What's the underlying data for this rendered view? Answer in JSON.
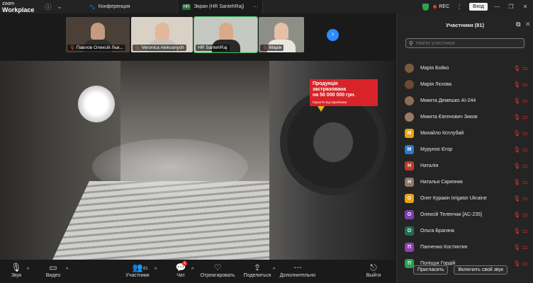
{
  "topbar": {
    "brand_line1": "zoom",
    "brand_line2": "Workplace",
    "tab1": "Конференция",
    "tab2_tag": "HR",
    "tab2": "Экран (HR SantehRaj)",
    "rec": "REC",
    "login": "Вход"
  },
  "thumbs": [
    {
      "label": "Павлов Олексій Льв...",
      "muted": true,
      "active": false
    },
    {
      "label": "Veronica Aleksanych",
      "muted": true,
      "active": false
    },
    {
      "label": "HR SantehRaj",
      "muted": false,
      "active": true
    },
    {
      "label": "Марія",
      "muted": true,
      "active": false
    }
  ],
  "promo": {
    "line1": "Продукція",
    "line2": "застрахована",
    "line3": "на 50 000 000 грн.",
    "line4": "Гарантія від виробника"
  },
  "toolbar": {
    "mic": "Звук",
    "video": "Видео",
    "participants": "Участники",
    "participants_count": "81",
    "chat": "Чат",
    "chat_badge": "1",
    "react": "Отреагировать",
    "share": "Поделиться",
    "more": "Дополнительно",
    "leave": "Выйти"
  },
  "panel": {
    "title": "Участники (81)",
    "search_placeholder": "Найти участника",
    "invite": "Пригласить",
    "enable_audio": "Включить свой звук",
    "participants": [
      {
        "name": "Марія Бойко",
        "initial": "",
        "color": "#7a5a3c",
        "photo": true
      },
      {
        "name": "Марія Лєхова",
        "initial": "",
        "color": "#6b4a32",
        "photo": true
      },
      {
        "name": "Микита Демешко АІ-244",
        "initial": "",
        "color": "#8a6d55",
        "photo": true
      },
      {
        "name": "Микита Євгенович Зиков",
        "initial": "",
        "color": "#9a7a62",
        "photo": true
      },
      {
        "name": "Михайло Котлубай",
        "initial": "М",
        "color": "#e8a317",
        "photo": false
      },
      {
        "name": "Муруноє Єгор",
        "initial": "М",
        "color": "#2f79c8",
        "photo": false
      },
      {
        "name": "Наталія",
        "initial": "Н",
        "color": "#c0392b",
        "photo": false
      },
      {
        "name": "Наталья Скрипник",
        "initial": "Н",
        "color": "#8a7a6a",
        "photo": false
      },
      {
        "name": "Олег Куракін Irrigator Ukraine",
        "initial": "О",
        "color": "#e8a317",
        "photo": false
      },
      {
        "name": "Олексій Теленчак [AC-235]",
        "initial": "О",
        "color": "#7b3fb0",
        "photo": false
      },
      {
        "name": "Ольга Брагина",
        "initial": "О",
        "color": "#1e6e4e",
        "photo": false
      },
      {
        "name": "Панченко Костянтин",
        "initial": "П",
        "color": "#8e3fb0",
        "photo": false
      },
      {
        "name": "Поліщук Гордій",
        "initial": "П",
        "color": "#2e9e4e",
        "photo": false
      }
    ]
  }
}
